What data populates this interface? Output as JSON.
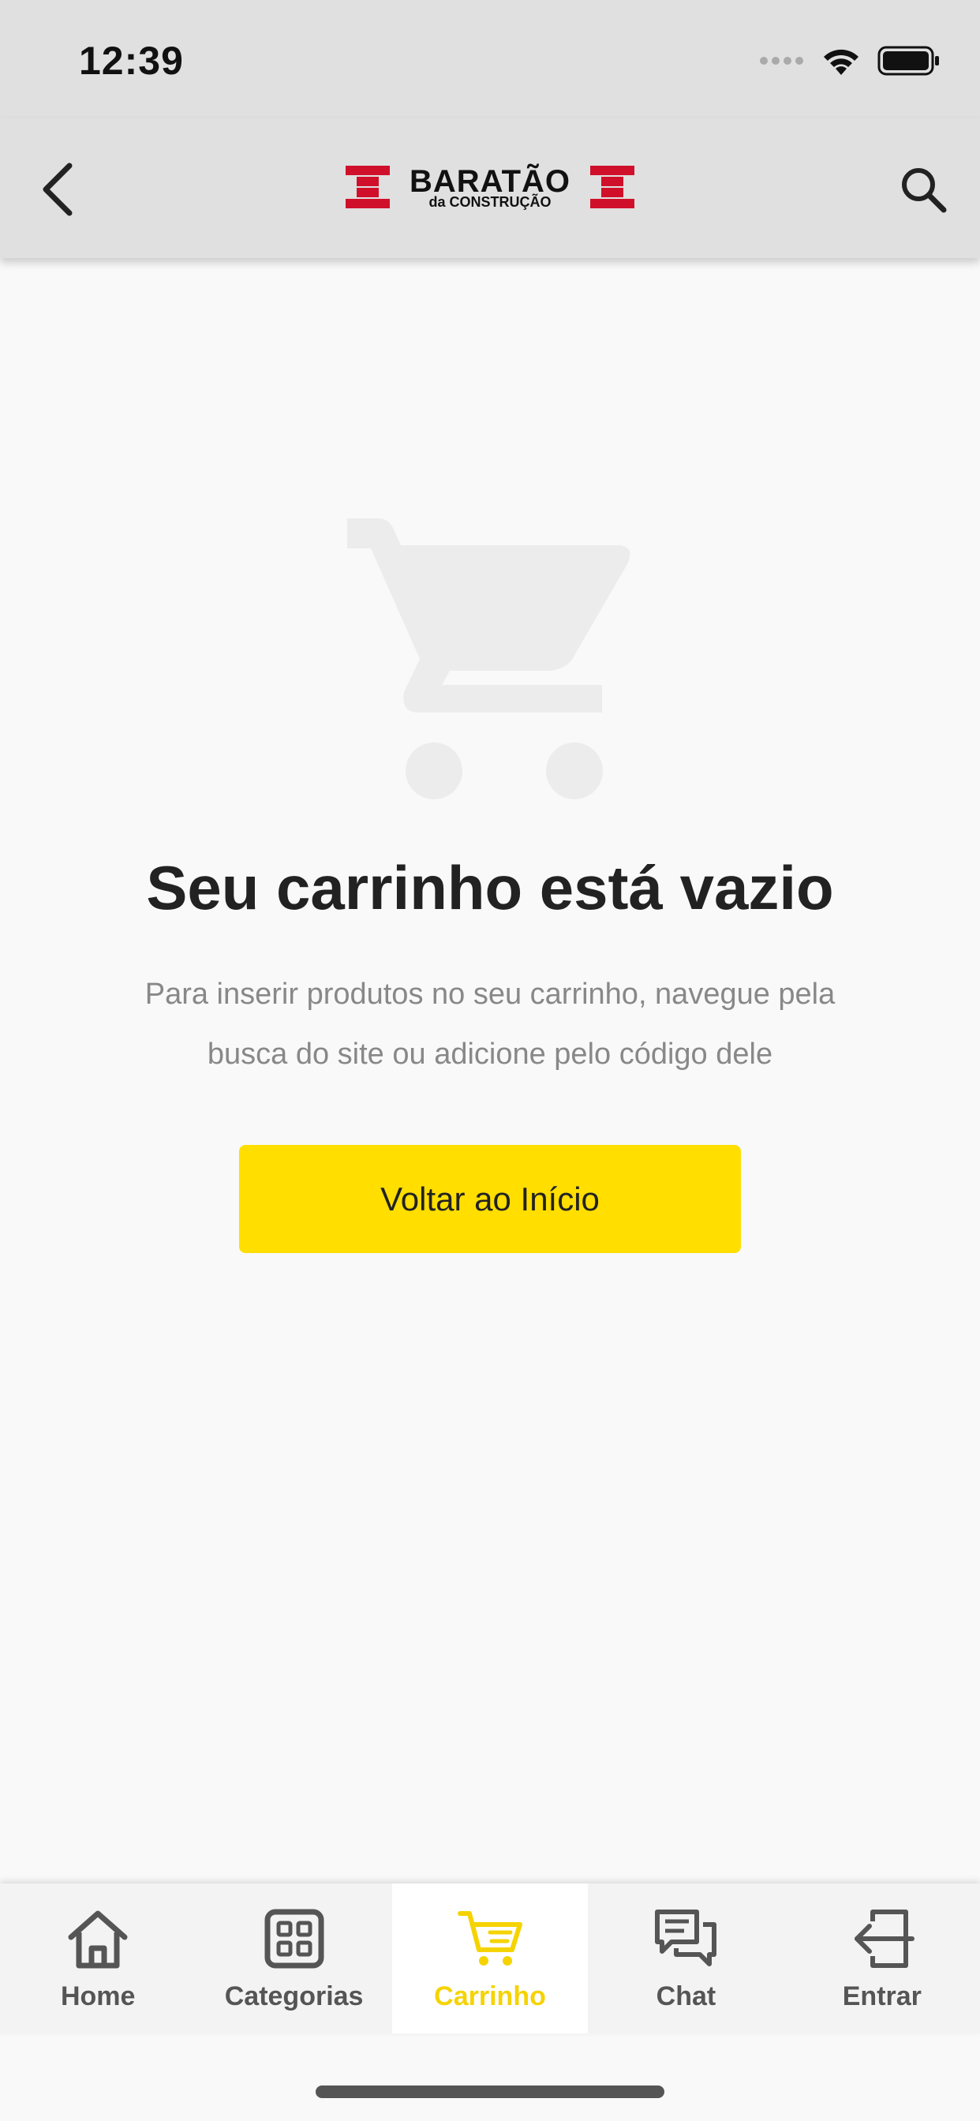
{
  "status_bar": {
    "time": "12:39"
  },
  "header": {
    "logo": {
      "main": "BARATÃO",
      "sub": "da CONSTRUÇÃO",
      "brand_color": "#d0102a"
    },
    "back_icon": "chevron-left-icon",
    "search_icon": "search-icon"
  },
  "empty_state": {
    "icon": "shopping-cart-icon",
    "title": "Seu carrinho está vazio",
    "description": "Para inserir produtos no seu carrinho, navegue pela busca do site ou adicione pelo código dele",
    "button_label": "Voltar ao Início",
    "button_color": "#ffde00"
  },
  "tab_bar": {
    "active_color": "#f5d300",
    "items": [
      {
        "label": "Home",
        "icon": "home-icon",
        "active": false
      },
      {
        "label": "Categorias",
        "icon": "grid-icon",
        "active": false
      },
      {
        "label": "Carrinho",
        "icon": "cart-icon",
        "active": true
      },
      {
        "label": "Chat",
        "icon": "chat-icon",
        "active": false
      },
      {
        "label": "Entrar",
        "icon": "login-icon",
        "active": false
      }
    ]
  }
}
